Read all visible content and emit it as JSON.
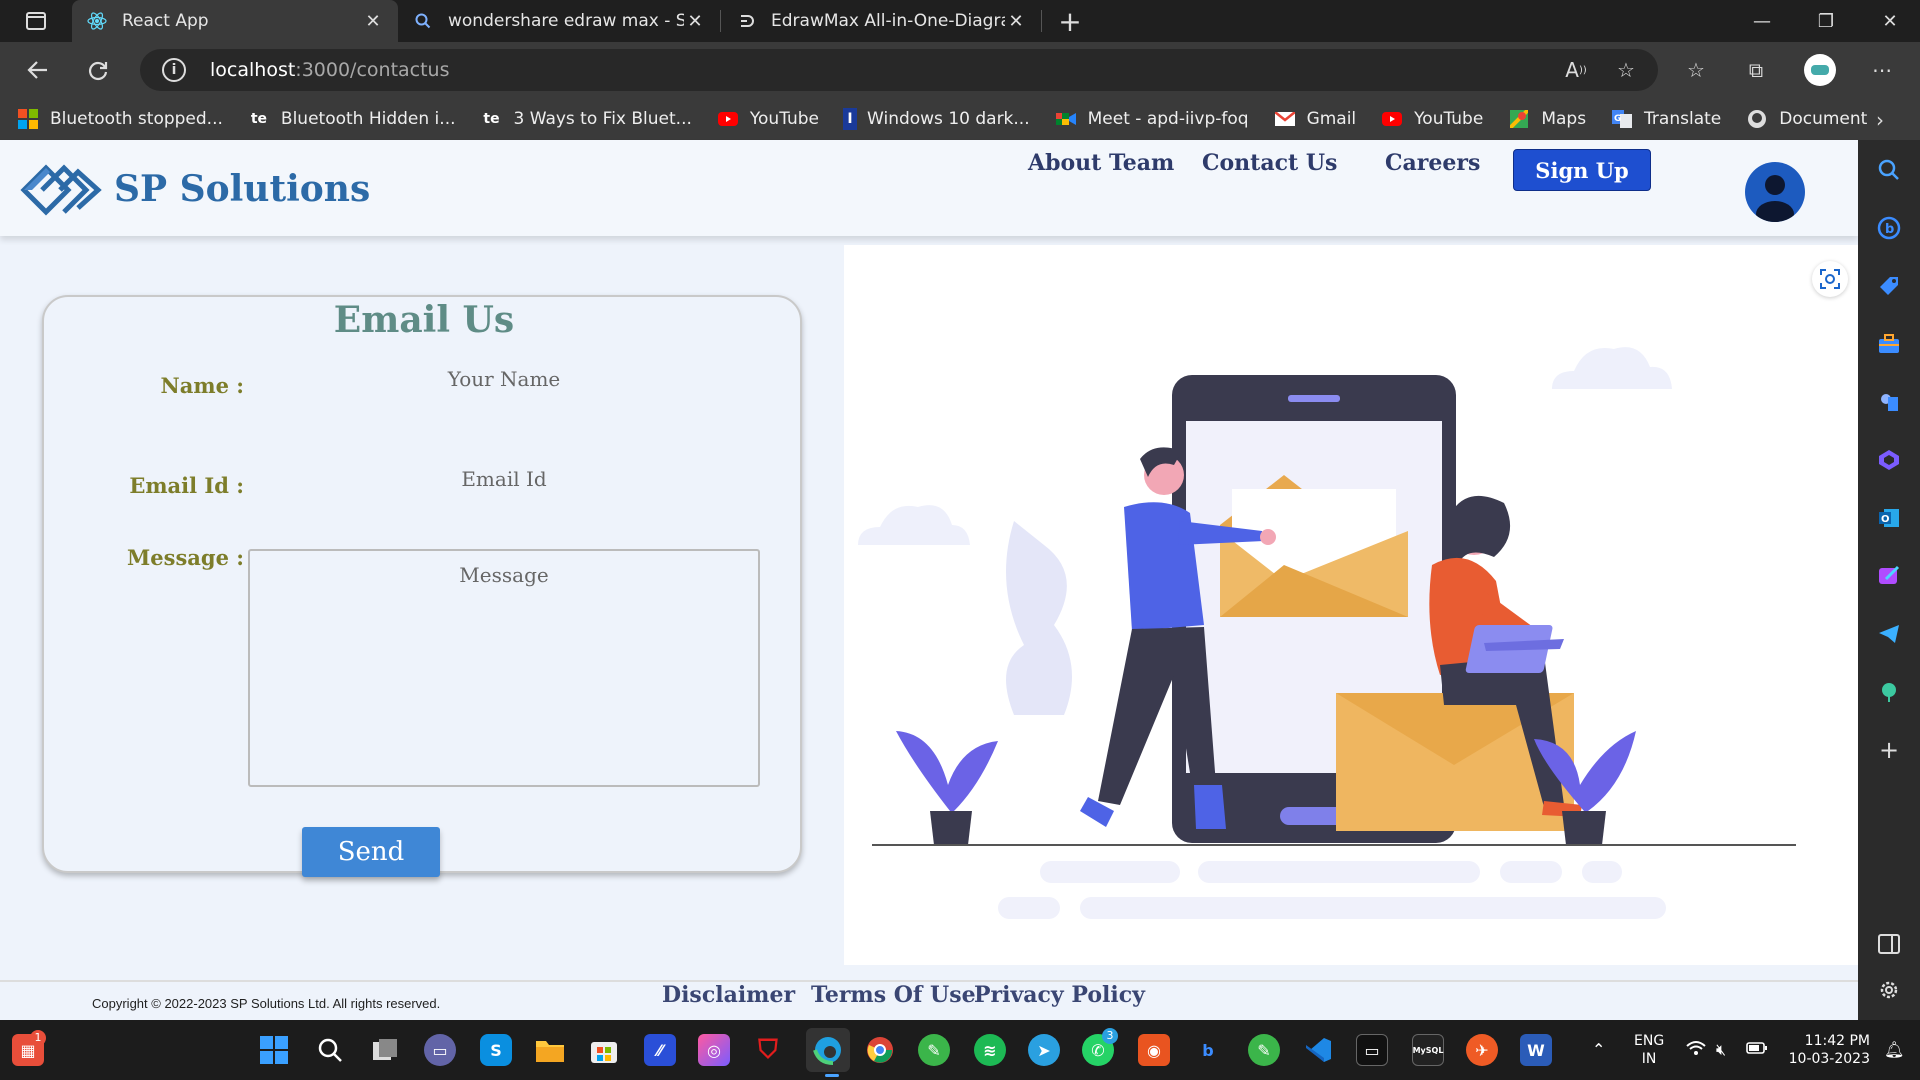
{
  "browser": {
    "tabs": [
      {
        "title": "React App",
        "icon": "react-icon",
        "active": true
      },
      {
        "title": "wondershare edraw max - Search",
        "icon": "search-icon",
        "active": false
      },
      {
        "title": "EdrawMax All-in-One-Diagram S",
        "icon": "edraw-icon",
        "active": false
      }
    ],
    "url_host": "localhost",
    "url_path": ":3000/contactus",
    "bookmarks": [
      {
        "label": "Bluetooth stopped...",
        "icon": "windows-logo-icon"
      },
      {
        "label": "Bluetooth Hidden i...",
        "icon": "te-icon"
      },
      {
        "label": "3 Ways to Fix Bluet...",
        "icon": "te-icon"
      },
      {
        "label": "YouTube",
        "icon": "youtube-icon"
      },
      {
        "label": "Windows 10 dark...",
        "icon": "bookmark-i-icon"
      },
      {
        "label": "Meet - apd-iivp-foq",
        "icon": "meet-icon"
      },
      {
        "label": "Gmail",
        "icon": "gmail-icon"
      },
      {
        "label": "YouTube",
        "icon": "youtube-icon"
      },
      {
        "label": "Maps",
        "icon": "maps-icon"
      },
      {
        "label": "Translate",
        "icon": "translate-icon"
      },
      {
        "label": "Document",
        "icon": "github-icon"
      }
    ]
  },
  "nav": {
    "brand": "SP Solutions",
    "links": [
      "About Team",
      "Contact Us",
      "Careers"
    ],
    "signup": "Sign Up"
  },
  "form": {
    "title": "Email Us",
    "name_label": "Name :",
    "name_placeholder": "Your Name",
    "email_label": "Email Id :",
    "email_placeholder": "Email Id",
    "message_label": "Message :",
    "message_placeholder": "Message",
    "send": "Send"
  },
  "footer": {
    "copyright": "Copyright © 2022-2023 SP Solutions Ltd. All rights reserved.",
    "links": [
      "Disclaimer",
      "Terms Of Use",
      "Privacy Policy"
    ]
  },
  "taskbar": {
    "lang_top": "ENG",
    "lang_bottom": "IN",
    "time": "11:42 PM",
    "date": "10-03-2023",
    "notification_badge": "1",
    "whatsapp_badge": "3"
  },
  "colors": {
    "brand": "#2c6aa7",
    "signup": "#1e4fd0",
    "send": "#3f87d6",
    "label": "#7d7d2a",
    "title": "#5f8c86"
  }
}
